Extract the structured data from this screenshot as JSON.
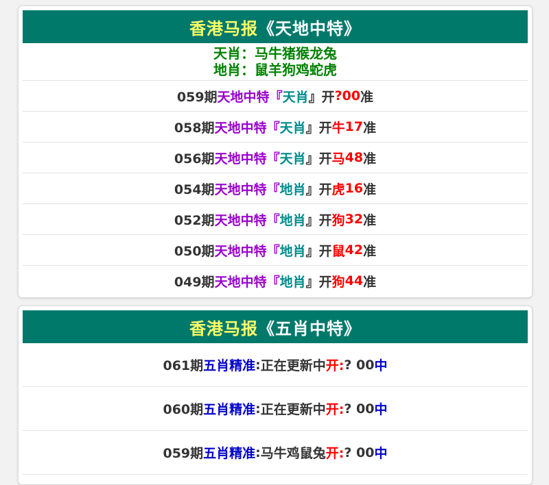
{
  "tiandi": {
    "header": {
      "brand": "香港马报",
      "title": "《天地中特》"
    },
    "tian_xiao": "天肖：马牛猪猴龙兔",
    "di_xiao": "地肖：鼠羊狗鸡蛇虎",
    "rows": [
      {
        "period": "059期",
        "name": "天地中特",
        "open": "『",
        "type": "天肖",
        "close": "』开",
        "zodiac": "?",
        "number": " 00",
        "suffix": "准"
      },
      {
        "period": "058期",
        "name": "天地中特",
        "open": "『",
        "type": "天肖",
        "close": "』开",
        "zodiac": "牛",
        "number": "17",
        "suffix": "准"
      },
      {
        "period": "056期",
        "name": "天地中特",
        "open": "『",
        "type": "天肖",
        "close": "』开",
        "zodiac": "马",
        "number": "48",
        "suffix": "准"
      },
      {
        "period": "054期",
        "name": "天地中特",
        "open": "『",
        "type": "地肖",
        "close": "』开",
        "zodiac": "虎",
        "number": "16",
        "suffix": "准"
      },
      {
        "period": "052期",
        "name": "天地中特",
        "open": "『",
        "type": "地肖",
        "close": "』开",
        "zodiac": "狗",
        "number": "32",
        "suffix": "准"
      },
      {
        "period": "050期",
        "name": "天地中特",
        "open": "『",
        "type": "地肖",
        "close": "』开",
        "zodiac": "鼠",
        "number": "42",
        "suffix": "准"
      },
      {
        "period": "049期",
        "name": "天地中特",
        "open": "『",
        "type": "地肖",
        "close": "』开",
        "zodiac": "狗",
        "number": "44",
        "suffix": "准"
      }
    ]
  },
  "wuxiao": {
    "header": {
      "brand": "香港马报",
      "title": "《五肖中特》"
    },
    "rows": [
      {
        "period": "061期",
        "name": "五肖精准",
        "colon": ":",
        "content": "正在更新中",
        "open": "开:",
        "result": "? 00",
        "hit": "中"
      },
      {
        "period": "060期",
        "name": "五肖精准",
        "colon": ":",
        "content": "正在更新中",
        "open": "开:",
        "result": "? 00",
        "hit": "中"
      },
      {
        "period": "059期",
        "name": "五肖精准",
        "colon": ":",
        "content": "马牛鸡鼠兔",
        "open": "开:",
        "result": "? 00",
        "hit": "中"
      }
    ]
  }
}
